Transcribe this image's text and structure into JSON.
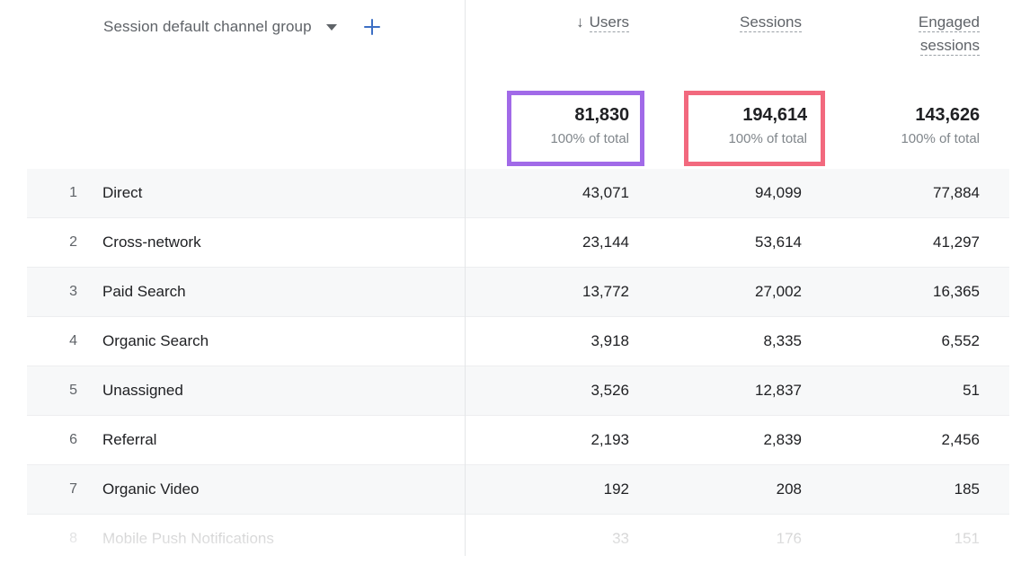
{
  "dimension_header": {
    "label": "Session default channel group",
    "caret_icon": "chevron-down-icon",
    "add_icon": "plus-icon"
  },
  "columns": [
    {
      "key": "users",
      "label": "Users",
      "sorted": true,
      "sort_icon": "arrow-down-icon",
      "sort_arrow": "↓"
    },
    {
      "key": "sessions",
      "label": "Sessions",
      "sorted": false
    },
    {
      "key": "engaged_sessions",
      "label_line1": "Engaged",
      "label_line2": "sessions",
      "sorted": false
    }
  ],
  "totals": {
    "users": {
      "value": "81,830",
      "sub": "100% of total"
    },
    "sessions": {
      "value": "194,614",
      "sub": "100% of total"
    },
    "engaged_sessions": {
      "value": "143,626",
      "sub": "100% of total"
    }
  },
  "highlights": {
    "users_box_color": "#a16ae8",
    "sessions_box_color": "#f2697e"
  },
  "rows": [
    {
      "index": "1",
      "label": "Direct",
      "users": "43,071",
      "sessions": "94,099",
      "engaged": "77,884"
    },
    {
      "index": "2",
      "label": "Cross-network",
      "users": "23,144",
      "sessions": "53,614",
      "engaged": "41,297"
    },
    {
      "index": "3",
      "label": "Paid Search",
      "users": "13,772",
      "sessions": "27,002",
      "engaged": "16,365"
    },
    {
      "index": "4",
      "label": "Organic Search",
      "users": "3,918",
      "sessions": "8,335",
      "engaged": "6,552"
    },
    {
      "index": "5",
      "label": "Unassigned",
      "users": "3,526",
      "sessions": "12,837",
      "engaged": "51"
    },
    {
      "index": "6",
      "label": "Referral",
      "users": "2,193",
      "sessions": "2,839",
      "engaged": "2,456"
    },
    {
      "index": "7",
      "label": "Organic Video",
      "users": "192",
      "sessions": "208",
      "engaged": "185"
    },
    {
      "index": "8",
      "label": "Mobile Push Notifications",
      "users": "33",
      "sessions": "176",
      "engaged": "151"
    }
  ],
  "chart_data": {
    "type": "table",
    "title": "Session default channel group",
    "columns": [
      "Session default channel group",
      "Users",
      "Sessions",
      "Engaged sessions"
    ],
    "totals": [
      "",
      "81,830",
      "194,614",
      "143,626"
    ],
    "categories": [
      "Direct",
      "Cross-network",
      "Paid Search",
      "Organic Search",
      "Unassigned",
      "Referral",
      "Organic Video",
      "Mobile Push Notifications"
    ],
    "series": [
      {
        "name": "Users",
        "values": [
          43071,
          23144,
          13772,
          3918,
          3526,
          2193,
          192,
          33
        ]
      },
      {
        "name": "Sessions",
        "values": [
          94099,
          53614,
          27002,
          8335,
          12837,
          2839,
          208,
          176
        ]
      },
      {
        "name": "Engaged sessions",
        "values": [
          77884,
          41297,
          16365,
          6552,
          51,
          2456,
          185,
          151
        ]
      }
    ],
    "sorted_by": "Users",
    "sort_direction": "descending"
  }
}
